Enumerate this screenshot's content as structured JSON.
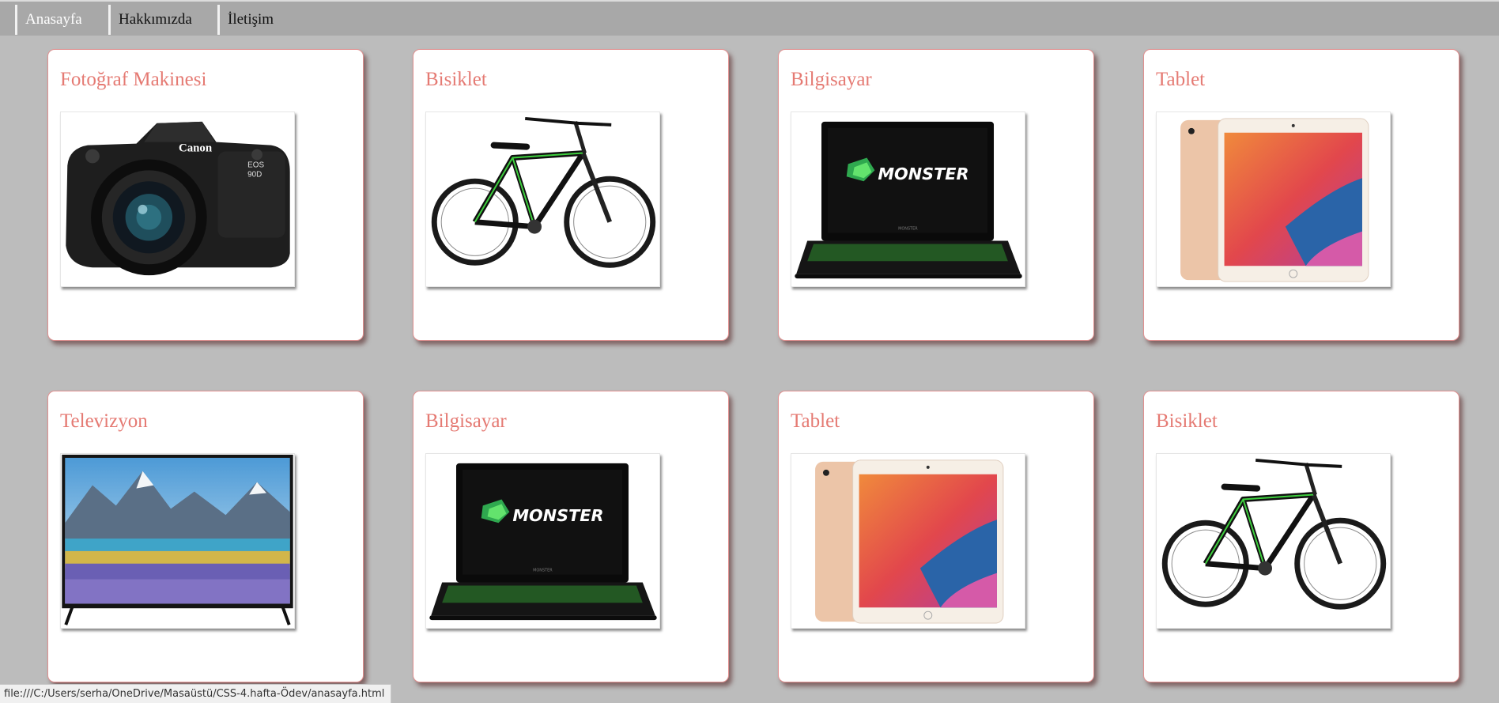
{
  "nav": {
    "items": [
      {
        "label": "Anasayfa",
        "active": true
      },
      {
        "label": "Hakkımızda",
        "active": false
      },
      {
        "label": "İletişim",
        "active": false
      }
    ]
  },
  "products": [
    {
      "title": "Fotoğraf Makinesi",
      "image": "camera"
    },
    {
      "title": "Bisiklet",
      "image": "bicycle"
    },
    {
      "title": "Bilgisayar",
      "image": "laptop"
    },
    {
      "title": "Tablet",
      "image": "tablet"
    },
    {
      "title": "Televizyon",
      "image": "television"
    },
    {
      "title": "Bilgisayar",
      "image": "laptop"
    },
    {
      "title": "Tablet",
      "image": "tablet"
    },
    {
      "title": "Bisiklet",
      "image": "bicycle"
    }
  ],
  "image_text": {
    "camera_brand": "Canon",
    "camera_model_line1": "EOS",
    "camera_model_line2": "90D",
    "laptop_brand": "MONSTER",
    "laptop_small_label": "MONSTER"
  },
  "statusbar": {
    "url": "file:///C:/Users/serha/OneDrive/Masaüstü/CSS-4.hafta-Ödev/anasayfa.html"
  },
  "colors": {
    "background": "#bcbcbc",
    "navbar": "#a8a8a8",
    "card_title": "#e57a73",
    "card_border": "#e09090"
  }
}
